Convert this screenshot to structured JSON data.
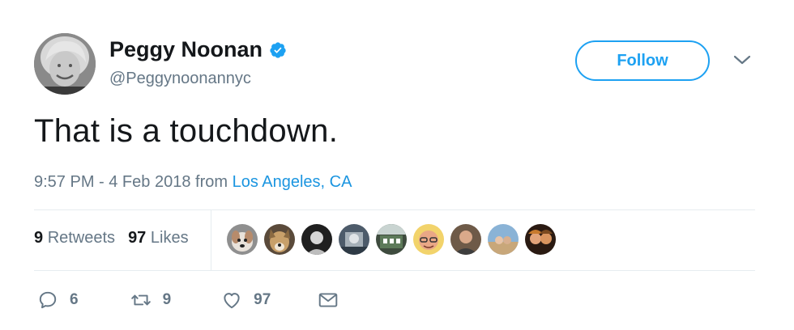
{
  "author": {
    "display_name": "Peggy Noonan",
    "handle": "@Peggynoonannyc",
    "avatar_icon": "author-avatar-photo",
    "verified_icon": "verified-badge-icon"
  },
  "follow_label": "Follow",
  "tweet_text": "That is a touchdown.",
  "meta": {
    "time_date": "9:57 PM - 4 Feb 2018",
    "from_word": "from",
    "location": "Los Angeles, CA"
  },
  "stats": {
    "retweets_count": "9",
    "retweets_label": "Retweets",
    "likes_count": "97",
    "likes_label": "Likes"
  },
  "actions": {
    "reply_count": "6",
    "retweet_count": "9",
    "like_count": "97"
  },
  "colors": {
    "accent": "#1da1f2",
    "link": "#1b95e0",
    "muted": "#657786",
    "divider": "#e6ecf0"
  }
}
